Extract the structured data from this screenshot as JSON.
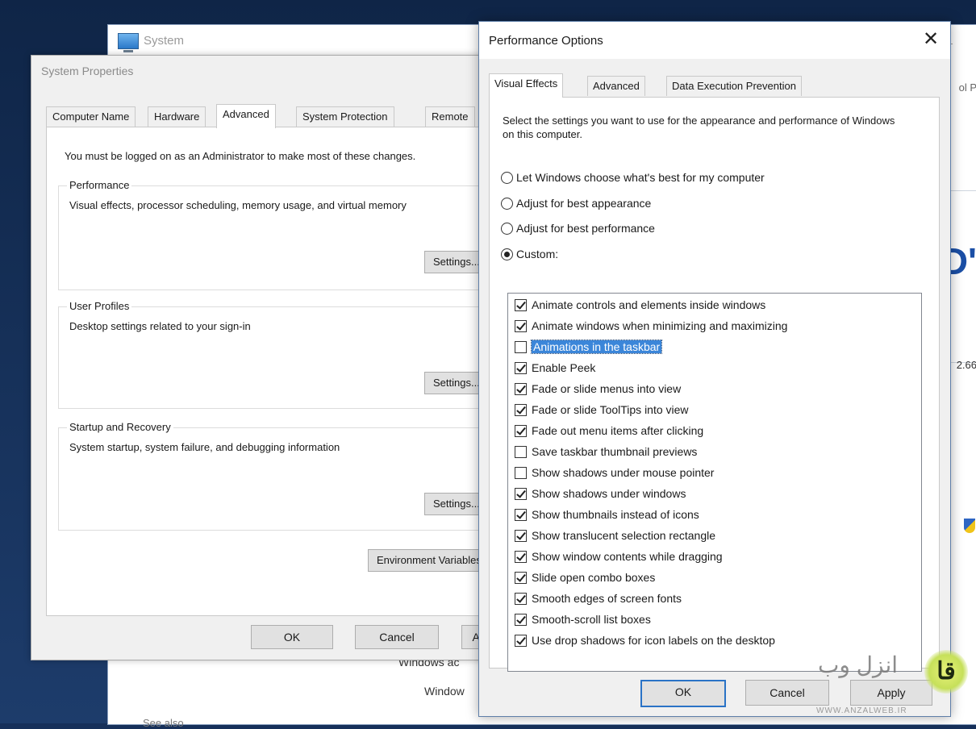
{
  "system_window": {
    "title": "System",
    "right_partial": "ol P",
    "big_partial": "D'",
    "number_partial": "2.66",
    "bottom_text_1": "Windows ac",
    "bottom_text_2": "Window",
    "bottom_text_3": "See also"
  },
  "system_properties": {
    "title": "System Properties",
    "tabs": [
      "Computer Name",
      "Hardware",
      "Advanced",
      "System Protection",
      "Remote"
    ],
    "active_tab": "Advanced",
    "admin_note": "You must be logged on as an Administrator to make most of these changes.",
    "groups": [
      {
        "label": "Performance",
        "description": "Visual effects, processor scheduling, memory usage, and virtual memory",
        "button": "Settings..."
      },
      {
        "label": "User Profiles",
        "description": "Desktop settings related to your sign-in",
        "button": "Settings..."
      },
      {
        "label": "Startup and Recovery",
        "description": "System startup, system failure, and debugging information",
        "button": "Settings..."
      }
    ],
    "env_button": "Environment Variables...",
    "buttons": {
      "ok": "OK",
      "cancel": "Cancel",
      "apply": "Apply"
    }
  },
  "performance_options": {
    "title": "Performance Options",
    "close_glyph": "✕",
    "tabs": [
      "Visual Effects",
      "Advanced",
      "Data Execution Prevention"
    ],
    "active_tab": "Visual Effects",
    "description": "Select the settings you want to use for the appearance and performance of Windows on this computer.",
    "radios": [
      {
        "label": "Let Windows choose what's best for my computer",
        "checked": false
      },
      {
        "label": "Adjust for best appearance",
        "checked": false
      },
      {
        "label": "Adjust for best performance",
        "checked": false
      },
      {
        "label": "Custom:",
        "checked": true
      }
    ],
    "options": [
      {
        "label": "Animate controls and elements inside windows",
        "checked": true
      },
      {
        "label": "Animate windows when minimizing and maximizing",
        "checked": true
      },
      {
        "label": "Animations in the taskbar",
        "checked": false,
        "selected": true
      },
      {
        "label": "Enable Peek",
        "checked": true
      },
      {
        "label": "Fade or slide menus into view",
        "checked": true
      },
      {
        "label": "Fade or slide ToolTips into view",
        "checked": true
      },
      {
        "label": "Fade out menu items after clicking",
        "checked": true
      },
      {
        "label": "Save taskbar thumbnail previews",
        "checked": false
      },
      {
        "label": "Show shadows under mouse pointer",
        "checked": false
      },
      {
        "label": "Show shadows under windows",
        "checked": true
      },
      {
        "label": "Show thumbnails instead of icons",
        "checked": true
      },
      {
        "label": "Show translucent selection rectangle",
        "checked": true
      },
      {
        "label": "Show window contents while dragging",
        "checked": true
      },
      {
        "label": "Slide open combo boxes",
        "checked": true
      },
      {
        "label": "Smooth edges of screen fonts",
        "checked": true
      },
      {
        "label": "Smooth-scroll list boxes",
        "checked": true
      },
      {
        "label": "Use drop shadows for icon labels on the desktop",
        "checked": true
      }
    ],
    "buttons": {
      "ok": "OK",
      "cancel": "Cancel",
      "apply": "Apply"
    }
  },
  "watermark": {
    "logo_glyph": "ﻗﺎ",
    "text": "انزل وب",
    "url": "WWW.ANZALWEB.IR"
  }
}
